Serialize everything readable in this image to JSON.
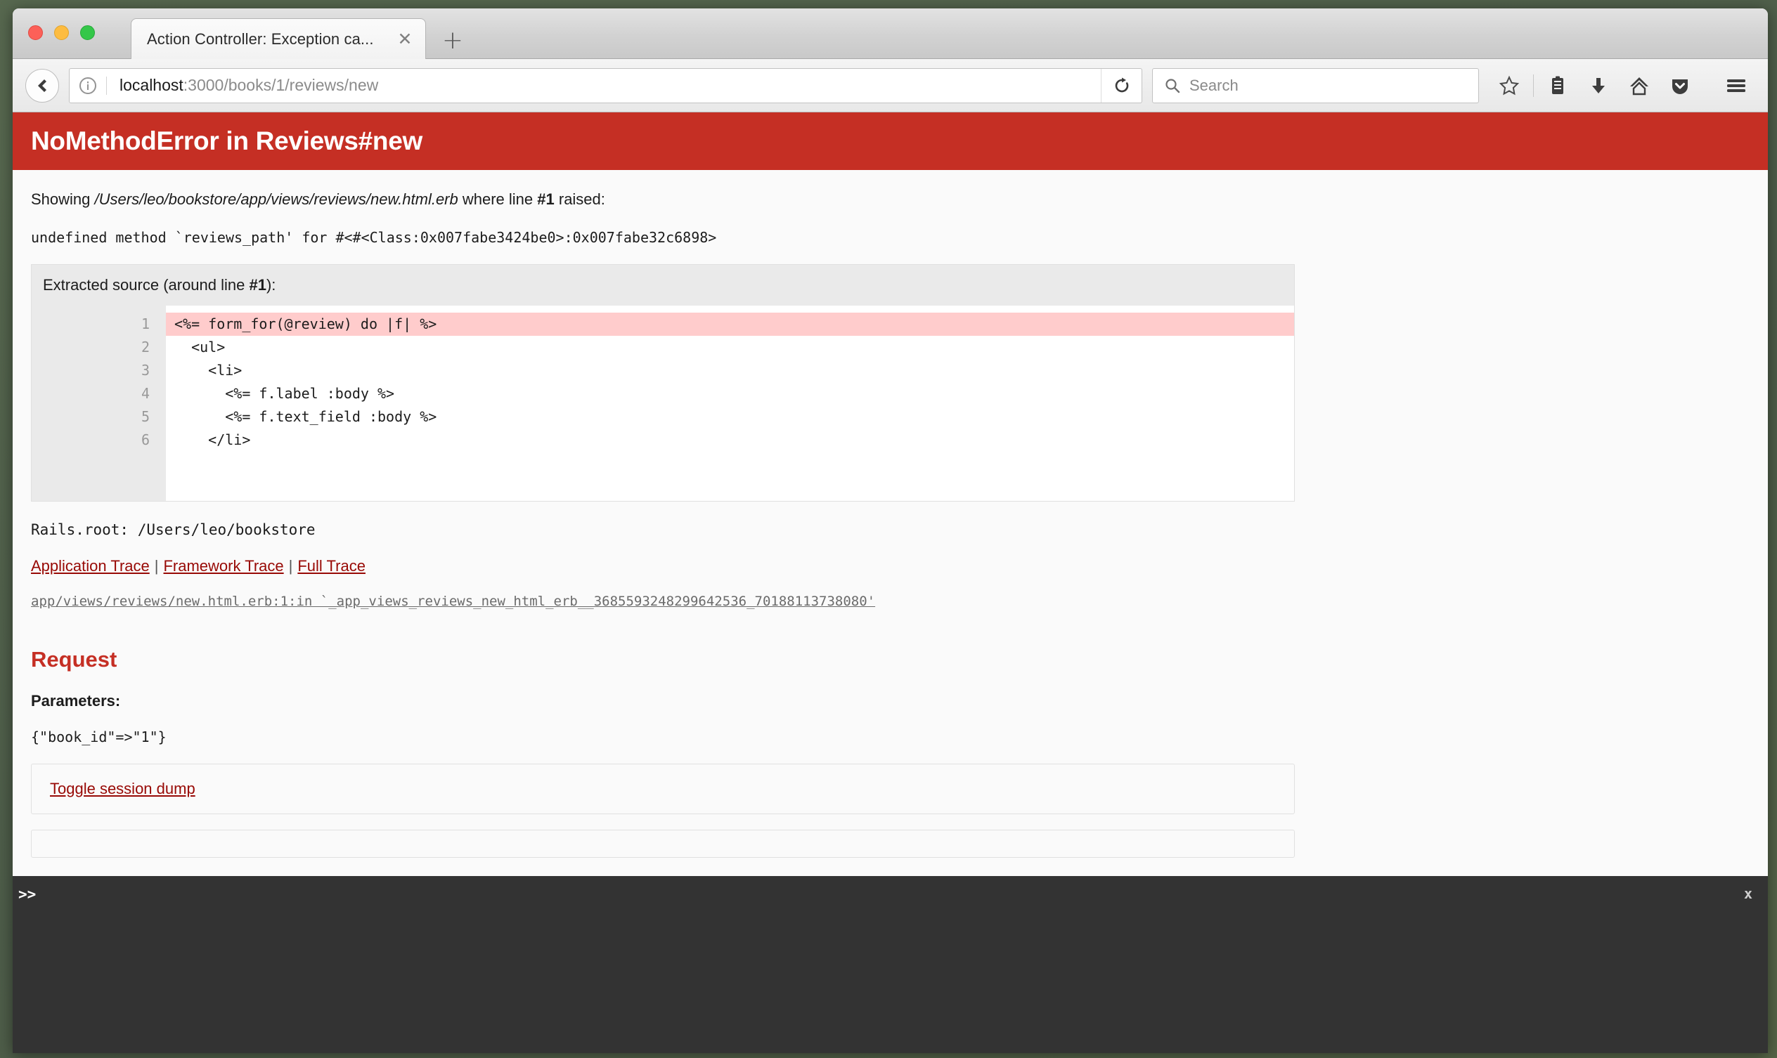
{
  "browser": {
    "tab_title": "Action Controller: Exception ca...",
    "tab_close_glyph": "✕",
    "new_tab_glyph": "+",
    "url_host": "localhost",
    "url_path": ":3000/books/1/reviews/new",
    "reload_glyph": "⟳",
    "search_placeholder": "Search",
    "icons": {
      "back": "back-arrow-icon",
      "info": "page-info-icon",
      "reload": "reload-icon",
      "search": "search-icon",
      "bookmark": "star-icon",
      "library": "library-icon",
      "downloads": "download-icon",
      "home": "home-icon",
      "pocket": "pocket-icon",
      "menu": "hamburger-menu-icon"
    }
  },
  "error_page": {
    "banner_title": "NoMethodError in Reviews#new",
    "banner_color": "#c52f24",
    "showing_prefix": "Showing ",
    "showing_file": "/Users/leo/bookstore/app/views/reviews/new.html.erb",
    "showing_middle": " where line ",
    "showing_line": "#1",
    "showing_suffix": " raised:",
    "error_message": "undefined method `reviews_path' for #<#<Class:0x007fabe3424be0>:0x007fabe32c6898>",
    "extracted_prefix": "Extracted source (around line ",
    "extracted_line": "#1",
    "extracted_suffix": "):",
    "source_lines": [
      {
        "num": "1",
        "code": "<%= form_for(@review) do |f| %>",
        "highlight": true
      },
      {
        "num": "2",
        "code": "  <ul>",
        "highlight": false
      },
      {
        "num": "3",
        "code": "    <li>",
        "highlight": false
      },
      {
        "num": "4",
        "code": "      <%= f.label :body %>",
        "highlight": false
      },
      {
        "num": "5",
        "code": "      <%= f.text_field :body %>",
        "highlight": false
      },
      {
        "num": "6",
        "code": "    </li>",
        "highlight": false
      }
    ],
    "rails_root": "Rails.root: /Users/leo/bookstore",
    "trace_links": {
      "application": "Application Trace",
      "framework": "Framework Trace",
      "full": "Full Trace",
      "separator": "|"
    },
    "trace_line": "app/views/reviews/new.html.erb:1:in `_app_views_reviews_new_html_erb__3685593248299642536_70188113738080'",
    "request_heading": "Request",
    "parameters_label": "Parameters:",
    "parameters_value": "{\"book_id\"=>\"1\"}",
    "toggle_session_dump": "Toggle session dump"
  },
  "console": {
    "prompt": ">>",
    "close_label": "x",
    "background": "#333333"
  }
}
